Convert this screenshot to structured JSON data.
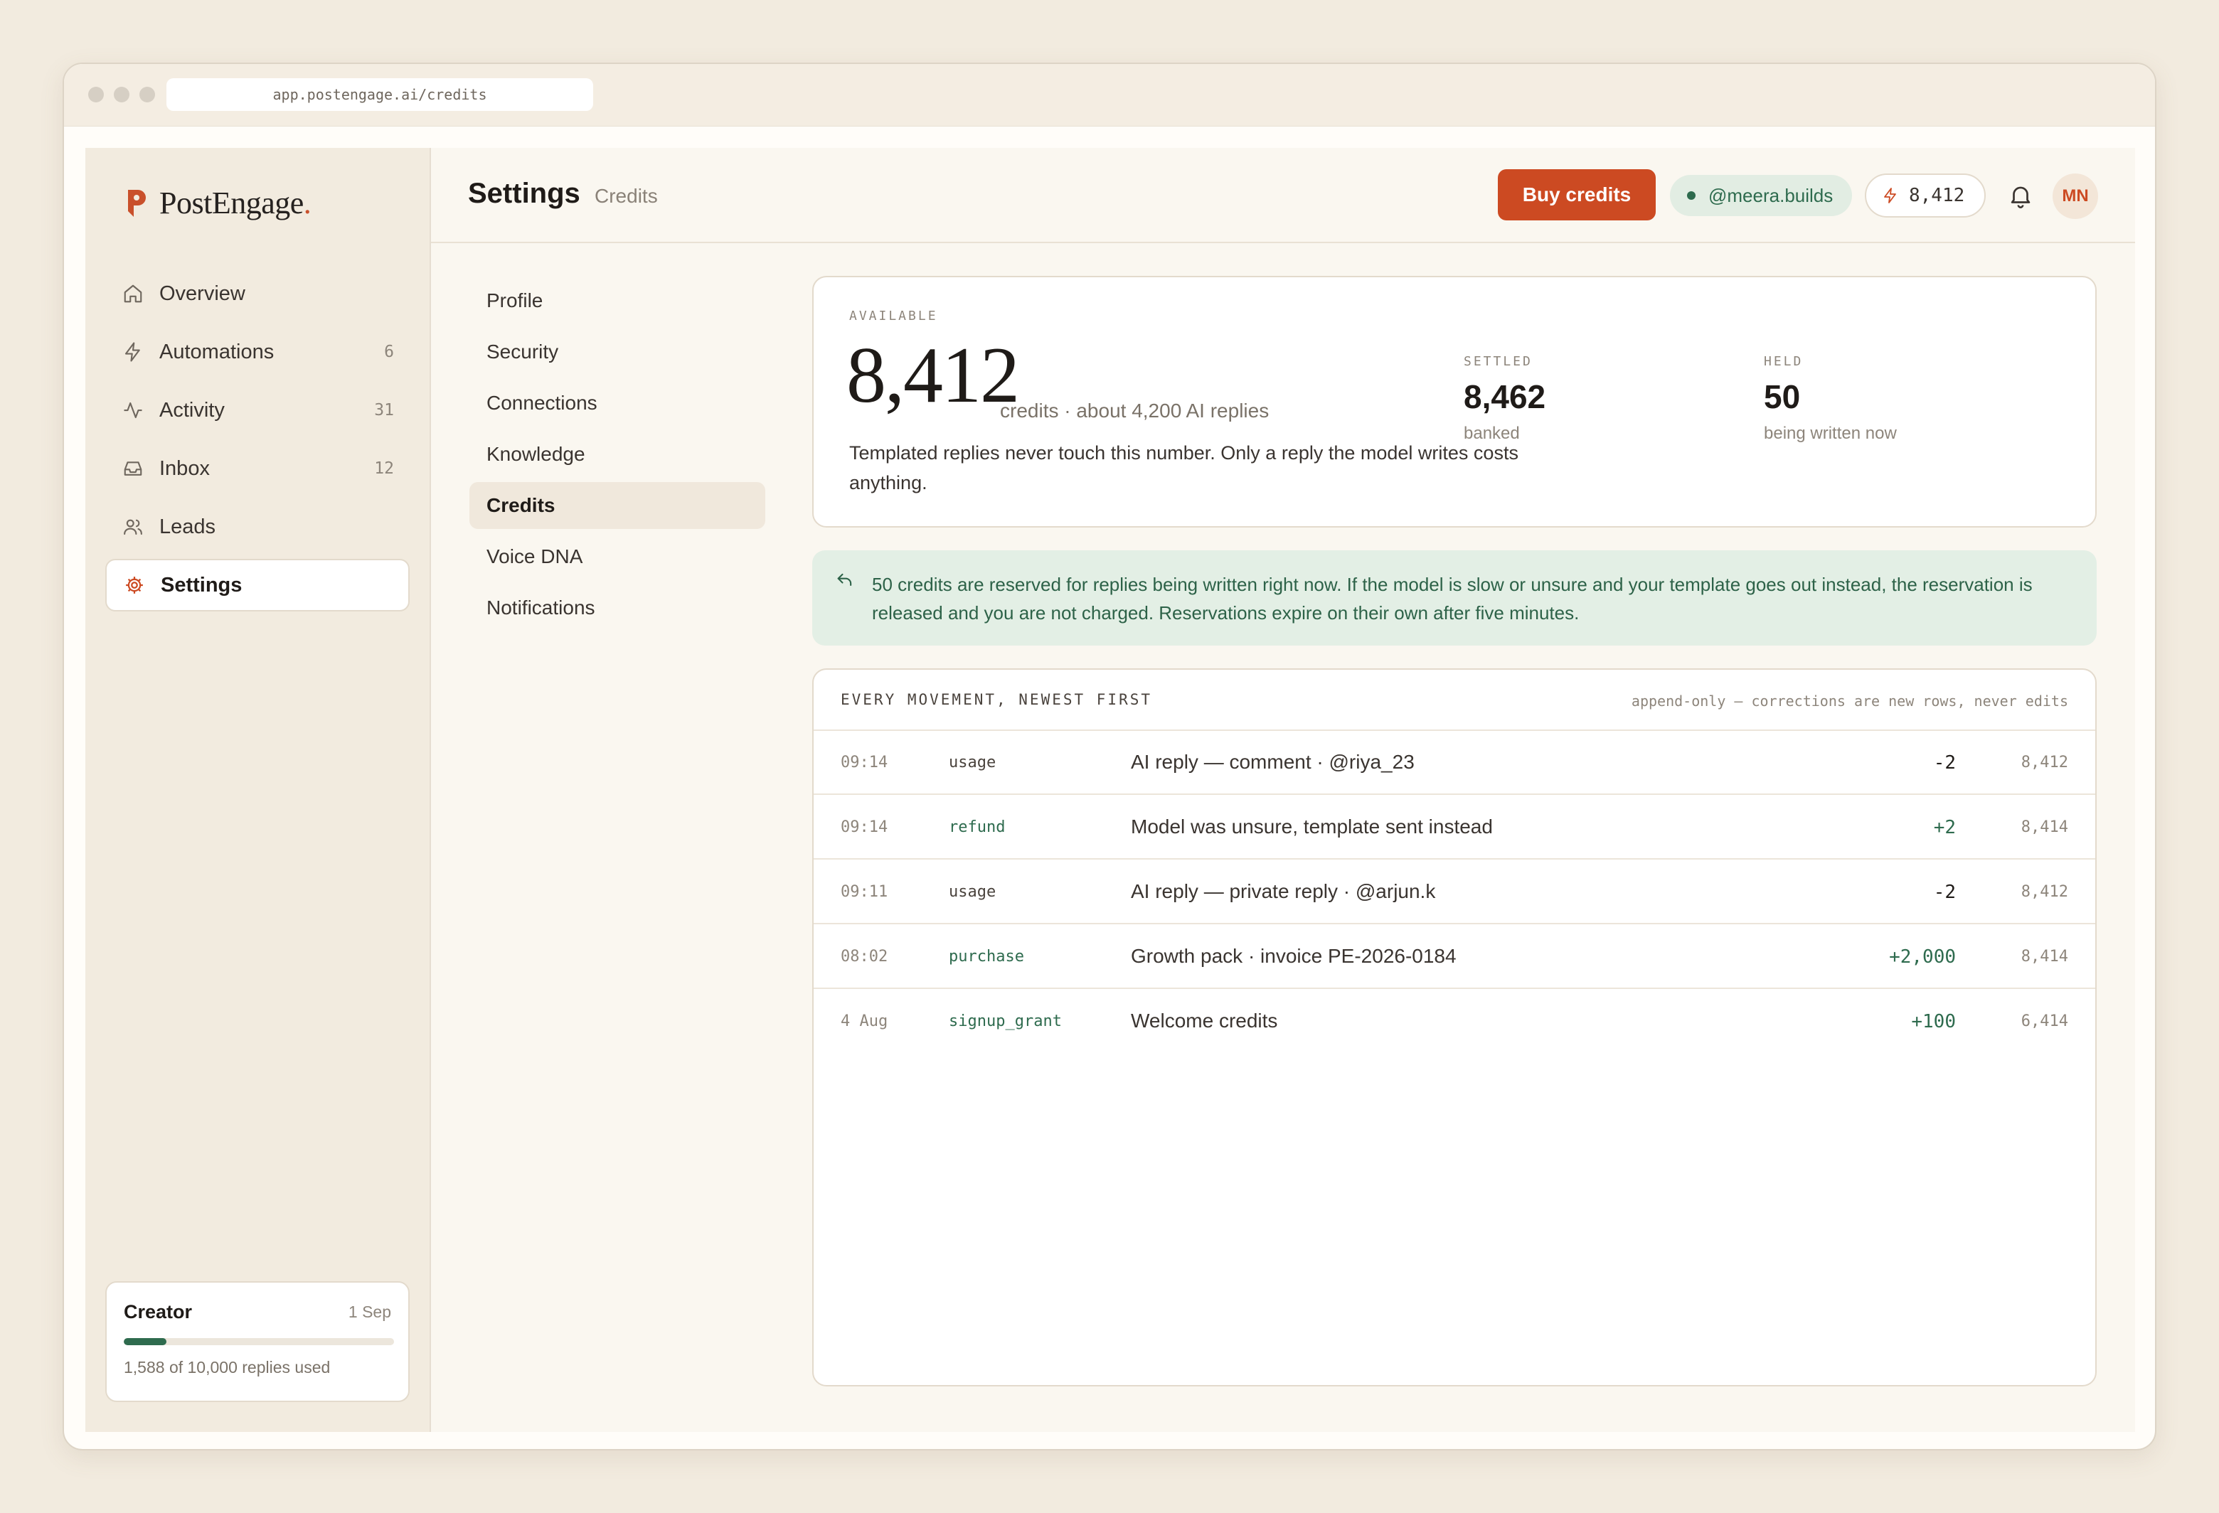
{
  "browser": {
    "url": "app.postengage.ai/credits"
  },
  "brand": {
    "name": "PostEngage",
    "dot": "."
  },
  "sidebar": {
    "items": [
      {
        "label": "Overview",
        "icon": "home-icon",
        "count": ""
      },
      {
        "label": "Automations",
        "icon": "bolt-icon",
        "count": "6"
      },
      {
        "label": "Activity",
        "icon": "pulse-icon",
        "count": "31"
      },
      {
        "label": "Inbox",
        "icon": "inbox-icon",
        "count": "12"
      },
      {
        "label": "Leads",
        "icon": "users-icon",
        "count": ""
      },
      {
        "label": "Settings",
        "icon": "gear-icon",
        "count": "",
        "active": true
      }
    ],
    "plan": {
      "name": "Creator",
      "renews": "1 Sep",
      "used_text": "1,588 of 10,000 replies used",
      "used_fraction": 0.1588
    }
  },
  "header": {
    "title": "Settings",
    "crumb": "Credits",
    "buy_label": "Buy credits",
    "handle": "@meera.builds",
    "credit_balance": "8,412",
    "avatar_initials": "MN"
  },
  "subnav": {
    "items": [
      "Profile",
      "Security",
      "Connections",
      "Knowledge",
      "Credits",
      "Voice DNA",
      "Notifications"
    ],
    "active": "Credits"
  },
  "balance": {
    "available_label": "AVAILABLE",
    "available_value": "8,412",
    "available_sub": "credits · about 4,200 AI replies",
    "note": "Templated replies never touch this number. Only a reply the model writes costs anything.",
    "settled_label": "SETTLED",
    "settled_value": "8,462",
    "settled_desc": "banked",
    "held_label": "HELD",
    "held_value": "50",
    "held_desc": "being written now"
  },
  "banner": {
    "text": "50 credits are reserved for replies being written right now. If the model is slow or unsure and your template goes out instead, the reservation is released and you are not charged. Reservations expire on their own after five minutes."
  },
  "ledger": {
    "title": "EVERY MOVEMENT, NEWEST FIRST",
    "note": "append-only — corrections are new rows, never edits",
    "rows": [
      {
        "time": "09:14",
        "type": "usage",
        "desc": "AI reply — comment · @riya_23",
        "delta": "-2",
        "balance": "8,412",
        "positive": false
      },
      {
        "time": "09:14",
        "type": "refund",
        "desc": "Model was unsure, template sent instead",
        "delta": "+2",
        "balance": "8,414",
        "positive": true
      },
      {
        "time": "09:11",
        "type": "usage",
        "desc": "AI reply — private reply · @arjun.k",
        "delta": "-2",
        "balance": "8,412",
        "positive": false
      },
      {
        "time": "08:02",
        "type": "purchase",
        "desc": "Growth pack · invoice PE-2026-0184",
        "delta": "+2,000",
        "balance": "8,414",
        "positive": true
      },
      {
        "time": "4 Aug",
        "type": "signup_grant",
        "desc": "Welcome credits",
        "delta": "+100",
        "balance": "6,414",
        "positive": true
      }
    ]
  },
  "colors": {
    "accent": "#cc4a22",
    "positive": "#2e6b4e",
    "background": "#f2ebdf"
  }
}
